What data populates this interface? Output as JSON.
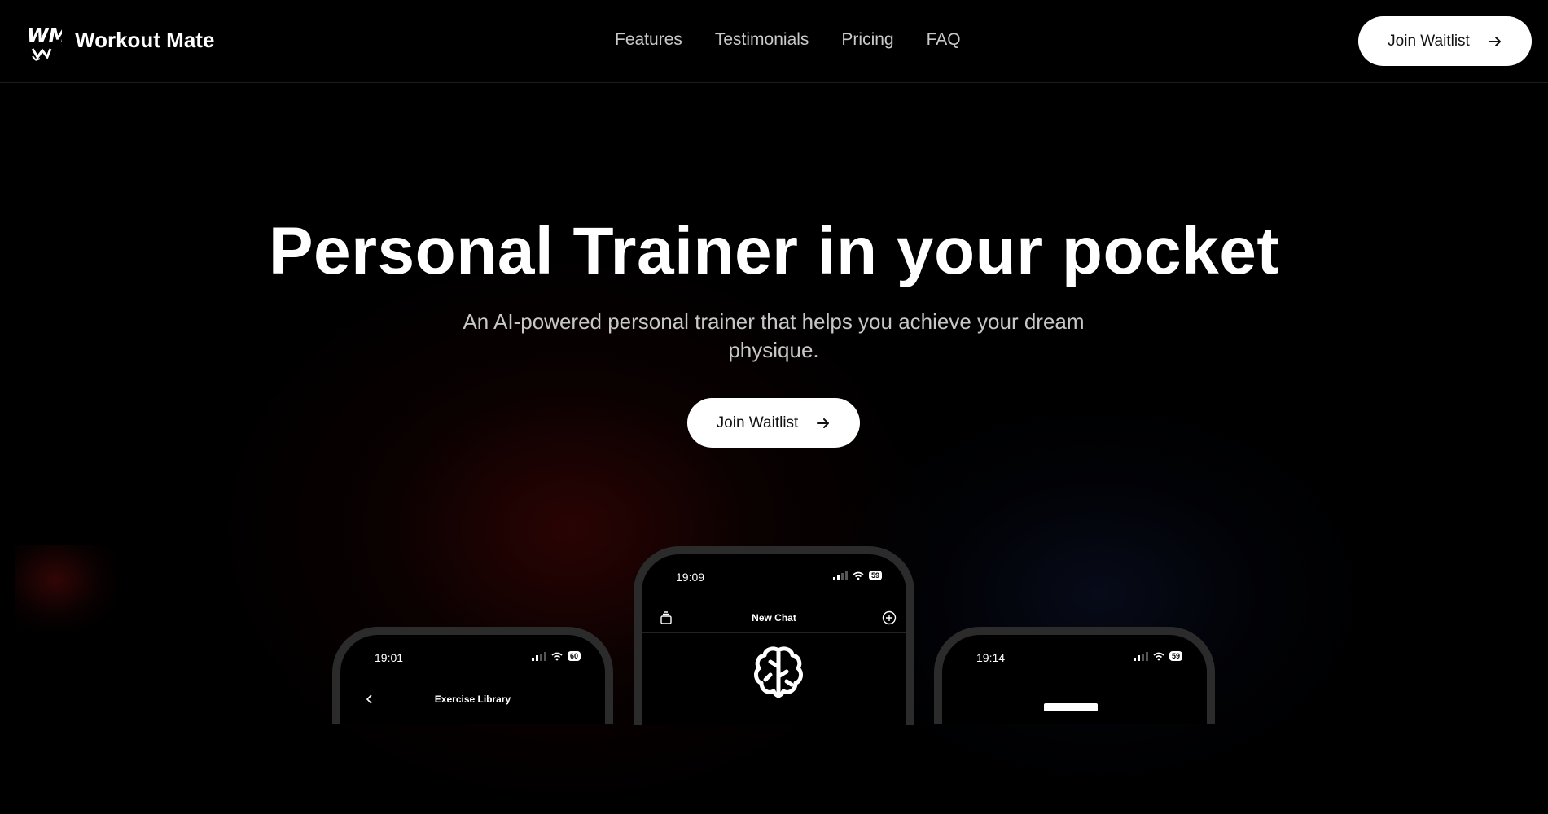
{
  "brand": {
    "name": "Workout Mate",
    "logo_text": "WM"
  },
  "nav": {
    "items": [
      "Features",
      "Testimonials",
      "Pricing",
      "FAQ"
    ]
  },
  "header": {
    "cta_label": "Join Waitlist"
  },
  "hero": {
    "title": "Personal Trainer in your pocket",
    "subtitle": "An AI-powered personal trainer that helps you achieve your dream physique.",
    "cta_label": "Join Waitlist"
  },
  "phones": {
    "left": {
      "time": "19:01",
      "battery": "60",
      "title": "Exercise Library"
    },
    "center": {
      "time": "19:09",
      "battery": "59",
      "title": "New Chat"
    },
    "right": {
      "time": "19:14",
      "battery": "59"
    }
  },
  "icons": [
    "logo",
    "arrow-right-icon",
    "back-chevron-icon",
    "history-icon",
    "new-chat-icon",
    "brain-icon",
    "wifi-icon",
    "signal-icon",
    "battery-icon"
  ],
  "colors": {
    "background": "#000000",
    "button_bg": "#ffffff",
    "button_text": "#111111",
    "nav_text": "#c9c9c9",
    "subtitle_text": "#c7c7c7"
  }
}
